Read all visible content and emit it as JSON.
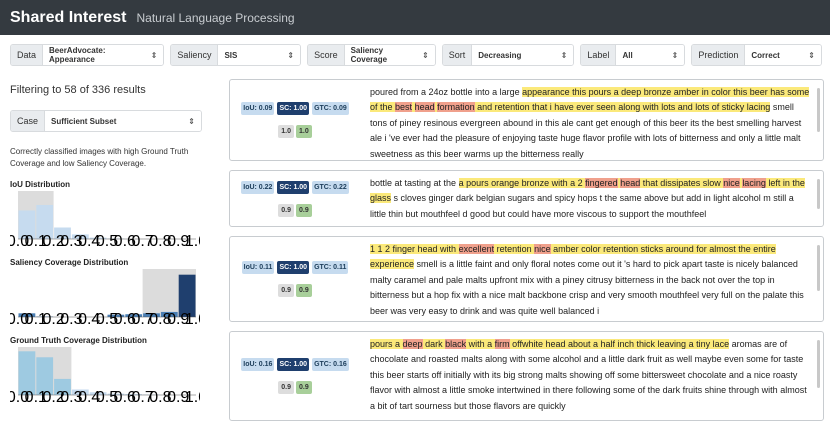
{
  "app": {
    "title": "Shared Interest",
    "subtitle": "Natural Language Processing"
  },
  "toolbar": [
    {
      "label": "Data",
      "value": "BeerAdvocate: Appearance",
      "width": 156
    },
    {
      "label": "Saliency",
      "value": "SIS",
      "width": 132
    },
    {
      "label": "Score",
      "value": "Saliency Coverage",
      "width": 130
    },
    {
      "label": "Sort",
      "value": "Decreasing",
      "width": 134
    },
    {
      "label": "Label",
      "value": "All",
      "width": 106
    },
    {
      "label": "Prediction",
      "value": "Correct",
      "width": 132
    }
  ],
  "filter": {
    "text": "Filtering to 58 of 336 results"
  },
  "case": {
    "label": "Case",
    "value": "Sufficient Subset"
  },
  "description": "Correctly classified images with high Ground Truth Coverage and low Saliency Coverage.",
  "histograms": [
    {
      "title": "IoU Distribution",
      "bins": [
        0.62,
        0.74,
        0.25,
        0.1,
        0.03,
        0.01,
        0,
        0,
        0,
        0
      ],
      "range": [
        0.0,
        0.2
      ],
      "color": "#c6dbef",
      "accent": "#c6dbef"
    },
    {
      "title": "Saliency Coverage Distribution",
      "bins": [
        0.08,
        0.01,
        0,
        0,
        0,
        0.05,
        0.06,
        0.08,
        0.11,
        0.92
      ],
      "range": [
        0.7,
        1.0
      ],
      "color": "#4a7fb5",
      "accent": "#1f3f6e"
    },
    {
      "title": "Ground Truth Coverage Distribution",
      "bins": [
        0.95,
        0.82,
        0.35,
        0.12,
        0.06,
        0.03,
        0.02,
        0.01,
        0,
        0
      ],
      "range": [
        0.0,
        0.3
      ],
      "color": "#c6dbef",
      "accent": "#9ecae1"
    }
  ],
  "tick_labels": [
    "0.0",
    "0.1",
    "0.2",
    "0.3",
    "0.4",
    "0.5",
    "0.6",
    "0.7",
    "0.8",
    "0.9",
    "1.0"
  ],
  "results": [
    {
      "iou": "IoU: 0.09",
      "sc": "SC: 1.00",
      "gtc": "GTC: 0.09",
      "label": "1.0",
      "prediction": "1.0",
      "tokens": [
        [
          "poured from a 24oz bottle into a large ",
          ""
        ],
        [
          "appearance this pours a deep bronze amber in color this beer has some of the ",
          "y"
        ],
        [
          "best",
          "r"
        ],
        [
          " ",
          "y"
        ],
        [
          "head",
          "r"
        ],
        [
          " ",
          "y"
        ],
        [
          "formation",
          "r"
        ],
        [
          " and retention that i have ever seen along with lots and lots of sticky lacing",
          "y"
        ],
        [
          " smell tons of piney resinous evergreen abound in this ale cant get enough of this beer its the best smelling harvest ale i 've ever had the pleasure of enjoying taste huge flavor profile with lots of bitterness and only a little malt sweetness as this beer warms up the bitterness really",
          ""
        ]
      ]
    },
    {
      "iou": "IoU: 0.22",
      "sc": "SC: 1.00",
      "gtc": "GTC: 0.22",
      "label": "0.9",
      "prediction": "0.9",
      "tokens": [
        [
          "bottle at tasting at the ",
          ""
        ],
        [
          "a pours orange bronze with a 2 ",
          "y"
        ],
        [
          "fingered",
          "r"
        ],
        [
          " ",
          "y"
        ],
        [
          "head",
          "r"
        ],
        [
          " that dissipates slow ",
          "y"
        ],
        [
          "nice",
          "r"
        ],
        [
          " ",
          "y"
        ],
        [
          "lacing",
          "r"
        ],
        [
          " left in the glass",
          "y"
        ],
        [
          " s cloves ginger dark belgian sugars and spicy hops t the same above but add in light alcohol m still a little thin but mouthfeel d good but could have more viscous to support the mouthfeel",
          ""
        ]
      ]
    },
    {
      "iou": "IoU: 0.11",
      "sc": "SC: 1.00",
      "gtc": "GTC: 0.11",
      "label": "0.9",
      "prediction": "0.9",
      "tokens": [
        [
          "1 1 2 finger head with ",
          "y"
        ],
        [
          "excellent",
          "r"
        ],
        [
          " retention ",
          "y"
        ],
        [
          "nice",
          "r"
        ],
        [
          " amber color retention sticks around for almost the entire experience",
          "y"
        ],
        [
          " smell is a little faint and only floral notes come out it 's hard to pick apart taste is nicely balanced malty caramel and pale malts upfront mix with a piney citrusy bitterness in the back not over the top in bitterness but a hop fix with a nice malt backbone crisp and very smooth mouthfeel very full on the palate this beer was very easy to drink and was quite well balanced i",
          ""
        ]
      ]
    },
    {
      "iou": "IoU: 0.16",
      "sc": "SC: 1.00",
      "gtc": "GTC: 0.16",
      "label": "0.9",
      "prediction": "0.9",
      "tokens": [
        [
          "pours a ",
          "y"
        ],
        [
          "deep",
          "r"
        ],
        [
          " dark ",
          "y"
        ],
        [
          "black",
          "r"
        ],
        [
          " with a ",
          "y"
        ],
        [
          "firm",
          "r"
        ],
        [
          " offwhite head about a half inch thick leaving a tiny lace",
          "y"
        ],
        [
          " aromas are of chocolate and roasted malts along with some alcohol and a little dark fruit as well maybe even some for taste this beer starts off initially with its big strong malts showing off some bittersweet chocolate and a nice roasty flavor with almost a little smoke intertwined in there following some of the dark fruits shine through with almost a bit of tart sourness but those flavors are quickly",
          ""
        ]
      ]
    }
  ]
}
